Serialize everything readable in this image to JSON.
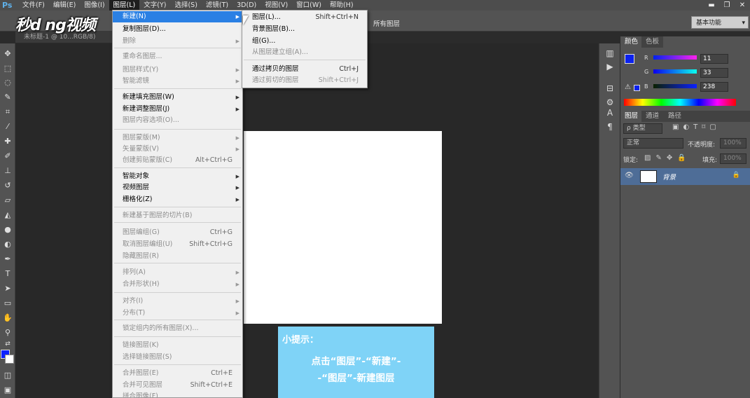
{
  "app": {
    "logo": "Ps"
  },
  "menubar": {
    "items": [
      "文件(F)",
      "编辑(E)",
      "图像(I)",
      "图层(L)",
      "文字(Y)",
      "选择(S)",
      "滤镜(T)",
      "3D(D)",
      "视图(V)",
      "窗口(W)",
      "帮助(H)"
    ],
    "active": "图层(L)"
  },
  "window_controls": {
    "minimize": "▬",
    "restore": "❐",
    "close": "✕"
  },
  "options_bar": {
    "all_layers": "所有图层",
    "workspace": "基本功能"
  },
  "watermark": "秒d ng视频",
  "document_tab": "未标题-1 @ 10...RGB/8)",
  "layer_menu": {
    "items": [
      {
        "label": "新建(N)",
        "shortcut": "",
        "submenu": true,
        "highlighted": true,
        "disabled": false
      },
      {
        "label": "复制图层(D)...",
        "shortcut": "",
        "submenu": false,
        "disabled": false
      },
      {
        "label": "删除",
        "shortcut": "",
        "submenu": true,
        "disabled": true
      },
      {
        "label": "重命名图层...",
        "shortcut": "",
        "submenu": false,
        "disabled": true
      },
      {
        "label": "图层样式(Y)",
        "shortcut": "",
        "submenu": true,
        "disabled": true
      },
      {
        "label": "智能滤镜",
        "shortcut": "",
        "submenu": true,
        "disabled": true
      },
      {
        "label": "新建填充图层(W)",
        "shortcut": "",
        "submenu": true,
        "disabled": false
      },
      {
        "label": "新建调整图层(J)",
        "shortcut": "",
        "submenu": true,
        "disabled": false
      },
      {
        "label": "图层内容选项(O)...",
        "shortcut": "",
        "submenu": false,
        "disabled": true
      },
      {
        "label": "图层蒙版(M)",
        "shortcut": "",
        "submenu": true,
        "disabled": true
      },
      {
        "label": "矢量蒙版(V)",
        "shortcut": "",
        "submenu": true,
        "disabled": true
      },
      {
        "label": "创建剪贴蒙版(C)",
        "shortcut": "Alt+Ctrl+G",
        "submenu": false,
        "disabled": true
      },
      {
        "label": "智能对象",
        "shortcut": "",
        "submenu": true,
        "disabled": false
      },
      {
        "label": "视频图层",
        "shortcut": "",
        "submenu": true,
        "disabled": false
      },
      {
        "label": "栅格化(Z)",
        "shortcut": "",
        "submenu": true,
        "disabled": false
      },
      {
        "label": "新建基于图层的切片(B)",
        "shortcut": "",
        "submenu": false,
        "disabled": true
      },
      {
        "label": "图层编组(G)",
        "shortcut": "Ctrl+G",
        "submenu": false,
        "disabled": true
      },
      {
        "label": "取消图层编组(U)",
        "shortcut": "Shift+Ctrl+G",
        "submenu": false,
        "disabled": true
      },
      {
        "label": "隐藏图层(R)",
        "shortcut": "",
        "submenu": false,
        "disabled": true
      },
      {
        "label": "排列(A)",
        "shortcut": "",
        "submenu": true,
        "disabled": true
      },
      {
        "label": "合并形状(H)",
        "shortcut": "",
        "submenu": true,
        "disabled": true
      },
      {
        "label": "对齐(I)",
        "shortcut": "",
        "submenu": true,
        "disabled": true
      },
      {
        "label": "分布(T)",
        "shortcut": "",
        "submenu": true,
        "disabled": true
      },
      {
        "label": "锁定组内的所有图层(X)...",
        "shortcut": "",
        "submenu": false,
        "disabled": true
      },
      {
        "label": "链接图层(K)",
        "shortcut": "",
        "submenu": false,
        "disabled": true
      },
      {
        "label": "选择链接图层(S)",
        "shortcut": "",
        "submenu": false,
        "disabled": true
      },
      {
        "label": "合并图层(E)",
        "shortcut": "Ctrl+E",
        "submenu": false,
        "disabled": true
      },
      {
        "label": "合并可见图层",
        "shortcut": "Shift+Ctrl+E",
        "submenu": false,
        "disabled": true
      },
      {
        "label": "拼合图像(F)",
        "shortcut": "",
        "submenu": false,
        "disabled": true
      }
    ]
  },
  "new_submenu": {
    "items": [
      {
        "label": "图层(L)...",
        "shortcut": "Shift+Ctrl+N",
        "disabled": false
      },
      {
        "label": "背景图层(B)...",
        "shortcut": "",
        "disabled": false
      },
      {
        "label": "组(G)...",
        "shortcut": "",
        "disabled": false
      },
      {
        "label": "从图层建立组(A)...",
        "shortcut": "",
        "disabled": true
      },
      {
        "label": "通过拷贝的图层",
        "shortcut": "Ctrl+J",
        "disabled": false
      },
      {
        "label": "通过剪切的图层",
        "shortcut": "Shift+Ctrl+J",
        "disabled": true
      }
    ]
  },
  "tip": {
    "title": "小提示：",
    "line1": "点击“图层”-“新建”-",
    "line2": "-“图层”-新建图层"
  },
  "color_panel": {
    "tabs": [
      "颜色",
      "色板"
    ],
    "channels": [
      {
        "label": "R",
        "value": "11"
      },
      {
        "label": "G",
        "value": "33"
      },
      {
        "label": "B",
        "value": "238"
      }
    ],
    "foreground": "#0b21ee"
  },
  "layers_panel": {
    "tabs": [
      "图层",
      "通道",
      "路径"
    ],
    "filter_label": "ρ 类型",
    "blend_mode": "正常",
    "opacity_label": "不透明度:",
    "opacity_value": "100%",
    "lock_label": "锁定:",
    "fill_label": "填充:",
    "fill_value": "100%",
    "layer_name": "背景"
  },
  "colors": {
    "accent": "#2a80e4",
    "tip_bg": "#7fd3f7",
    "layer_selected": "#4e6d97"
  }
}
